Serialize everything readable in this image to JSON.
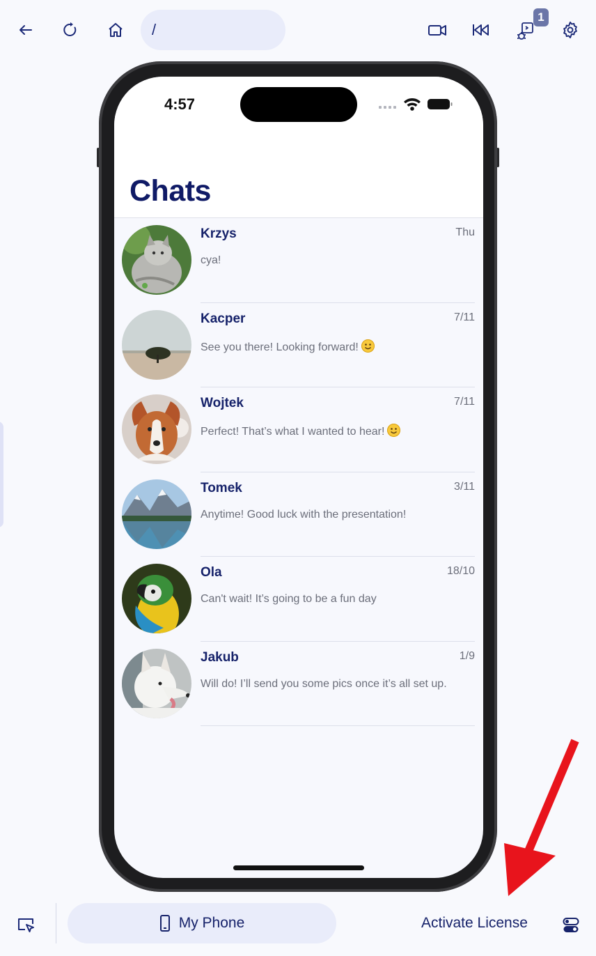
{
  "toolbar": {
    "url": "/",
    "badge_count": "1",
    "icons": [
      "back-arrow-icon",
      "reload-icon",
      "home-icon",
      "video-record-icon",
      "rewind-icon",
      "debugger-icon",
      "gear-icon"
    ]
  },
  "phone": {
    "status_time": "4:57",
    "title": "Chats",
    "chats": [
      {
        "name": "Krzys",
        "date": "Thu",
        "message": "cya!",
        "emoji": false,
        "avatar": "cat"
      },
      {
        "name": "Kacper",
        "date": "7/11",
        "message": "See you there! Looking forward!",
        "emoji": true,
        "avatar": "tree"
      },
      {
        "name": "Wojtek",
        "date": "7/11",
        "message": "Perfect! That’s what I wanted to hear!",
        "emoji": true,
        "avatar": "dog"
      },
      {
        "name": "Tomek",
        "date": "3/11",
        "message": "Anytime! Good luck with the presentation!",
        "emoji": false,
        "avatar": "mountains"
      },
      {
        "name": "Ola",
        "date": "18/10",
        "message": "Can't wait! It’s going to be a fun day",
        "emoji": false,
        "avatar": "parrot"
      },
      {
        "name": "Jakub",
        "date": "1/9",
        "message": "Will do! I’ll send you some pics once it’s all set up.",
        "emoji": false,
        "avatar": "white-dog"
      }
    ]
  },
  "bottom": {
    "device_label": "My Phone",
    "license_label": "Activate License"
  },
  "colors": {
    "accent": "#1c2a78",
    "pill_bg": "#e9ecfa",
    "title": "#0f1a66",
    "annotation_arrow": "#e8141c"
  }
}
